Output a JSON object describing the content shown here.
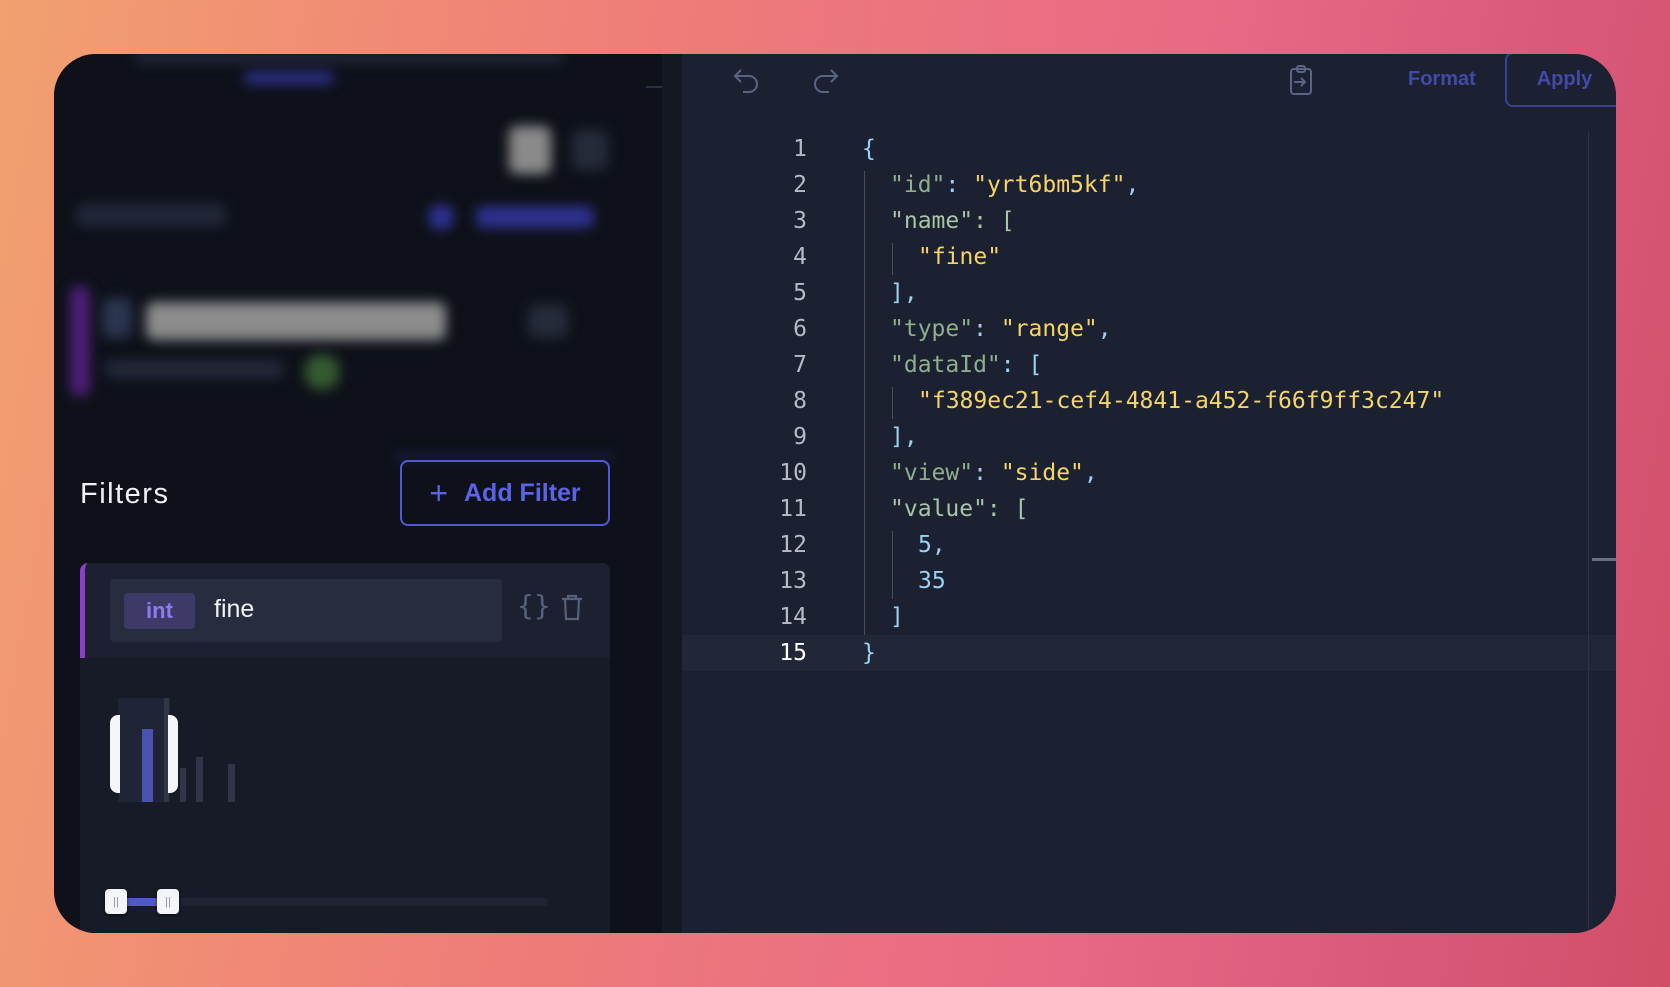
{
  "left_panel": {
    "filters_title": "Filters",
    "add_filter_label": "Add Filter",
    "filter": {
      "type_badge": "int",
      "field_name": "fine",
      "accent_color": "#8a3fc4",
      "range_min": "5",
      "range_max": "35",
      "selected_range": [
        5,
        35
      ],
      "histogram_icons": [
        "json-icon",
        "trash-icon"
      ]
    }
  },
  "editor": {
    "toolbar": {
      "format_label": "Format",
      "apply_label": "Apply",
      "icons": [
        "undo-icon",
        "redo-icon",
        "paste-clipboard-icon"
      ]
    },
    "current_line": 15,
    "lines": [
      {
        "n": "1",
        "t": "{"
      },
      {
        "n": "2",
        "t": "\"id\": \"yrt6bm5kf\","
      },
      {
        "n": "3",
        "t": "\"name\": ["
      },
      {
        "n": "4",
        "t": "\"fine\""
      },
      {
        "n": "5",
        "t": "],"
      },
      {
        "n": "6",
        "t": "\"type\": \"range\","
      },
      {
        "n": "7",
        "t": "\"dataId\": ["
      },
      {
        "n": "8",
        "t": "\"f389ec21-cef4-4841-a452-f66f9ff3c247\""
      },
      {
        "n": "9",
        "t": "],"
      },
      {
        "n": "10",
        "t": "\"view\": \"side\","
      },
      {
        "n": "11",
        "t": "\"value\": ["
      },
      {
        "n": "12",
        "t": "5,"
      },
      {
        "n": "13",
        "t": "35"
      },
      {
        "n": "14",
        "t": "]"
      },
      {
        "n": "15",
        "t": "}"
      }
    ]
  }
}
